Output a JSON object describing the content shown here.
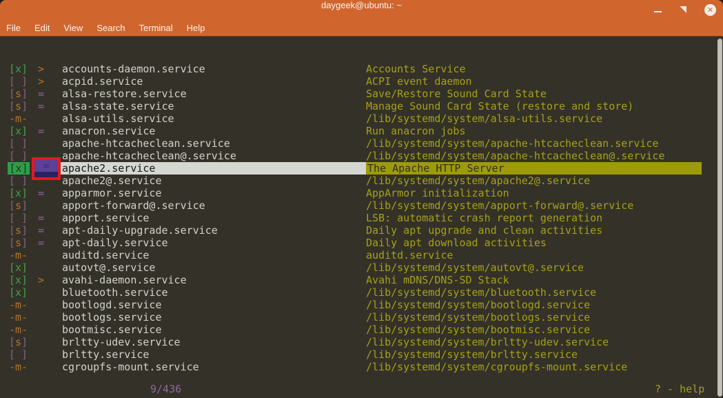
{
  "window": {
    "title": "daygeek@ubuntu: ~",
    "controls": [
      {
        "icon": "minimize-icon"
      },
      {
        "icon": "restore-icon"
      },
      {
        "icon": "close-icon",
        "glyph": "✕"
      }
    ]
  },
  "menu": {
    "items": [
      "File",
      "Edit",
      "View",
      "Search",
      "Terminal",
      "Help"
    ]
  },
  "colors": {
    "titlebar_orange": "#d0662e",
    "terminal_background": "#343129",
    "service_name_text": "#d0d4cc",
    "description_olive": "#a5a216",
    "state_enabled_green": "#3fa24a",
    "state_empty_purple": "#84618c",
    "symbol_purple": "#8c6a9e",
    "symbol_orange": "#b4752c",
    "selection_gray": "#d5d8d0",
    "selection_olive": "#9e9b0b",
    "selection_green_block": "#2f9e49",
    "annotation_violet": "#5b4197",
    "annotation_indigo": "#272261",
    "annotation_red": "#e6181d",
    "scrollbar_gray": "#c2beba"
  },
  "services": {
    "rows": [
      {
        "state": "[x]",
        "state_type": "x",
        "arrow": ">",
        "name": "accounts-daemon.service",
        "desc": "Accounts Service"
      },
      {
        "state": "[ ]",
        "state_type": "empty",
        "arrow": ">",
        "name": "acpid.service",
        "desc": "ACPI event daemon"
      },
      {
        "state": "[s]",
        "state_type": "s",
        "arrow": "=",
        "name": "alsa-restore.service",
        "desc": "Save/Restore Sound Card State"
      },
      {
        "state": "[s]",
        "state_type": "s",
        "arrow": "=",
        "name": "alsa-state.service",
        "desc": "Manage Sound Card State (restore and store)"
      },
      {
        "state": "-m-",
        "state_type": "m",
        "arrow": "",
        "name": "alsa-utils.service",
        "desc": "/lib/systemd/system/alsa-utils.service"
      },
      {
        "state": "[x]",
        "state_type": "x",
        "arrow": "=",
        "name": "anacron.service",
        "desc": "Run anacron jobs"
      },
      {
        "state": "[ ]",
        "state_type": "empty",
        "arrow": "",
        "name": "apache-htcacheclean.service",
        "desc": "/lib/systemd/system/apache-htcacheclean.service"
      },
      {
        "state": "[ ]",
        "state_type": "empty",
        "arrow": "",
        "name": "apache-htcacheclean@.service",
        "desc": "/lib/systemd/system/apache-htcacheclean@.service"
      },
      {
        "state": "[x]",
        "state_type": "x",
        "arrow": "=",
        "name": "apache2.service",
        "desc": "The Apache HTTP Server",
        "selected": true,
        "annotated": true
      },
      {
        "state": "[ ]",
        "state_type": "empty",
        "arrow": "",
        "name": "apache2@.service",
        "desc": "/lib/systemd/system/apache2@.service"
      },
      {
        "state": "[x]",
        "state_type": "x",
        "arrow": "=",
        "name": "apparmor.service",
        "desc": "AppArmor initialization"
      },
      {
        "state": "[s]",
        "state_type": "s",
        "arrow": "",
        "name": "apport-forward@.service",
        "desc": "/lib/systemd/system/apport-forward@.service"
      },
      {
        "state": "[ ]",
        "state_type": "empty",
        "arrow": "=",
        "name": "apport.service",
        "desc": "LSB: automatic crash report generation"
      },
      {
        "state": "[s]",
        "state_type": "s",
        "arrow": "=",
        "name": "apt-daily-upgrade.service",
        "desc": "Daily apt upgrade and clean activities"
      },
      {
        "state": "[s]",
        "state_type": "s",
        "arrow": "=",
        "name": "apt-daily.service",
        "desc": "Daily apt download activities"
      },
      {
        "state": "-m-",
        "state_type": "m",
        "arrow": "",
        "name": "auditd.service",
        "desc": "auditd.service"
      },
      {
        "state": "[x]",
        "state_type": "x",
        "arrow": "",
        "name": "autovt@.service",
        "desc": "/lib/systemd/system/autovt@.service"
      },
      {
        "state": "[x]",
        "state_type": "x",
        "arrow": ">",
        "name": "avahi-daemon.service",
        "desc": "Avahi mDNS/DNS-SD Stack"
      },
      {
        "state": "[x]",
        "state_type": "x",
        "arrow": "",
        "name": "bluetooth.service",
        "desc": "/lib/systemd/system/bluetooth.service"
      },
      {
        "state": "-m-",
        "state_type": "m",
        "arrow": "",
        "name": "bootlogd.service",
        "desc": "/lib/systemd/system/bootlogd.service"
      },
      {
        "state": "-m-",
        "state_type": "m",
        "arrow": "",
        "name": "bootlogs.service",
        "desc": "/lib/systemd/system/bootlogs.service"
      },
      {
        "state": "-m-",
        "state_type": "m",
        "arrow": "",
        "name": "bootmisc.service",
        "desc": "/lib/systemd/system/bootmisc.service"
      },
      {
        "state": "[s]",
        "state_type": "s",
        "arrow": "",
        "name": "brltty-udev.service",
        "desc": "/lib/systemd/system/brltty-udev.service"
      },
      {
        "state": "[ ]",
        "state_type": "empty",
        "arrow": "",
        "name": "brltty.service",
        "desc": "/lib/systemd/system/brltty.service"
      },
      {
        "state": "-m-",
        "state_type": "m",
        "arrow": "",
        "name": "cgroupfs-mount.service",
        "desc": "/lib/systemd/system/cgroupfs-mount.service"
      }
    ],
    "counter": "9/436",
    "help_hint": "? - help"
  }
}
